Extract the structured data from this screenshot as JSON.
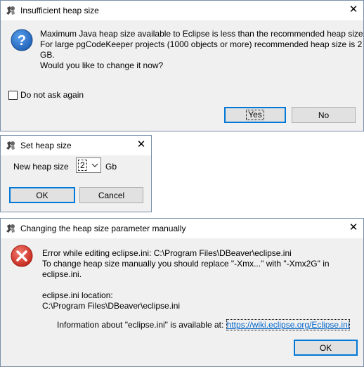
{
  "dialog1": {
    "title": "Insufficient heap size",
    "message_lines": [
      "Maximum Java heap size available to Eclipse is less than the recommended heap size.",
      "For large pgCodeKeeper projects (1000 objects or more) recommended heap size is 2",
      "GB.",
      "Would you like to change it now?"
    ],
    "checkbox_label": "Do not ask again",
    "checkbox_checked": false,
    "yes_label": "Yes",
    "no_label": "No"
  },
  "dialog2": {
    "title": "Set heap size",
    "field_label": "New heap size",
    "select_value": "2",
    "unit": "Gb",
    "ok_label": "OK",
    "cancel_label": "Cancel"
  },
  "dialog3": {
    "title": "Changing the heap size parameter manually",
    "lines": [
      "Error while editing eclipse.ini: C:\\Program Files\\DBeaver\\eclipse.ini",
      "To change heap size manually you should replace \"-Xmx...\" with \"-Xmx2G\" in",
      "eclipse.ini."
    ],
    "location_label": "eclipse.ini location:",
    "location_path": "C:\\Program Files\\DBeaver\\eclipse.ini",
    "info_text": "Information about \"eclipse.ini\" is available at:",
    "info_link": "https://wiki.eclipse.org/Eclipse.ini",
    "ok_label": "OK"
  },
  "colors": {
    "dialog_bg": "#f0f0f0",
    "titlebar_bg": "#ffffff",
    "accent": "#0078d7",
    "link": "#0066cc",
    "question_icon": "#1e5fb4",
    "error_icon": "#d9362b"
  },
  "icons": {
    "app": "eclipse-app-icon",
    "question": "question-icon",
    "error": "error-icon",
    "close": "close-icon"
  }
}
